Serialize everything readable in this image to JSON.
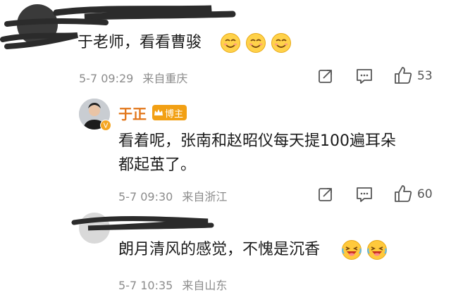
{
  "comments": [
    {
      "text": "于老师，看看曹骏",
      "date": "5-7 09:29",
      "location": "来自重庆",
      "likes": "53"
    },
    {
      "author": "于正",
      "badge": "博主",
      "text_line1": "看着呢，张南和赵昭仪每天提100遍耳朵",
      "text_line2": "都起茧了。",
      "date": "5-7 09:30",
      "location": "来自浙江",
      "likes": "60"
    },
    {
      "text": "朗月清风的感觉，不愧是沉香",
      "date": "5-7 10:35",
      "location": "来自山东"
    }
  ],
  "icons": {
    "share": "share-icon",
    "comment": "comment-icon",
    "like": "thumbs-up-icon",
    "smile_emoji": "smiling-face-emoji",
    "laugh_emoji": "laughing-face-emoji"
  },
  "colors": {
    "author": "#e2761a",
    "badge": "#f2a014",
    "meta": "#8c8c8c"
  }
}
